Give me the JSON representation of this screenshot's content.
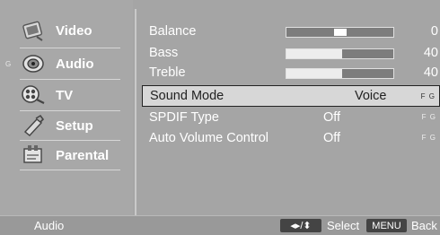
{
  "sidebar": {
    "items": [
      {
        "label": "Video",
        "icon": "video-icon"
      },
      {
        "label": "Audio",
        "icon": "audio-icon",
        "marker": "G"
      },
      {
        "label": "TV",
        "icon": "tv-icon"
      },
      {
        "label": "Setup",
        "icon": "setup-icon"
      },
      {
        "label": "Parental",
        "icon": "parental-icon"
      }
    ]
  },
  "menu": {
    "balance": {
      "label": "Balance",
      "value": "0",
      "level": 0.5
    },
    "bass": {
      "label": "Bass",
      "value": "40",
      "level": 0.52
    },
    "treble": {
      "label": "Treble",
      "value": "40",
      "level": 0.52
    },
    "sound_mode": {
      "label": "Sound Mode",
      "value": "Voice",
      "tail": "F G"
    },
    "spdif": {
      "label": "SPDIF Type",
      "value": "Off",
      "tail": "F G"
    },
    "avc": {
      "label": "Auto Volume Control",
      "value": "Off",
      "tail": "F G"
    }
  },
  "statusbar": {
    "title": "Audio",
    "select_key": "◂▸/⬍",
    "select_label": "Select",
    "menu_key": "MENU",
    "back_label": "Back"
  },
  "colors": {
    "background": "#a5a5a5",
    "selected_row": "#d7d7d7",
    "key": "#444444"
  }
}
